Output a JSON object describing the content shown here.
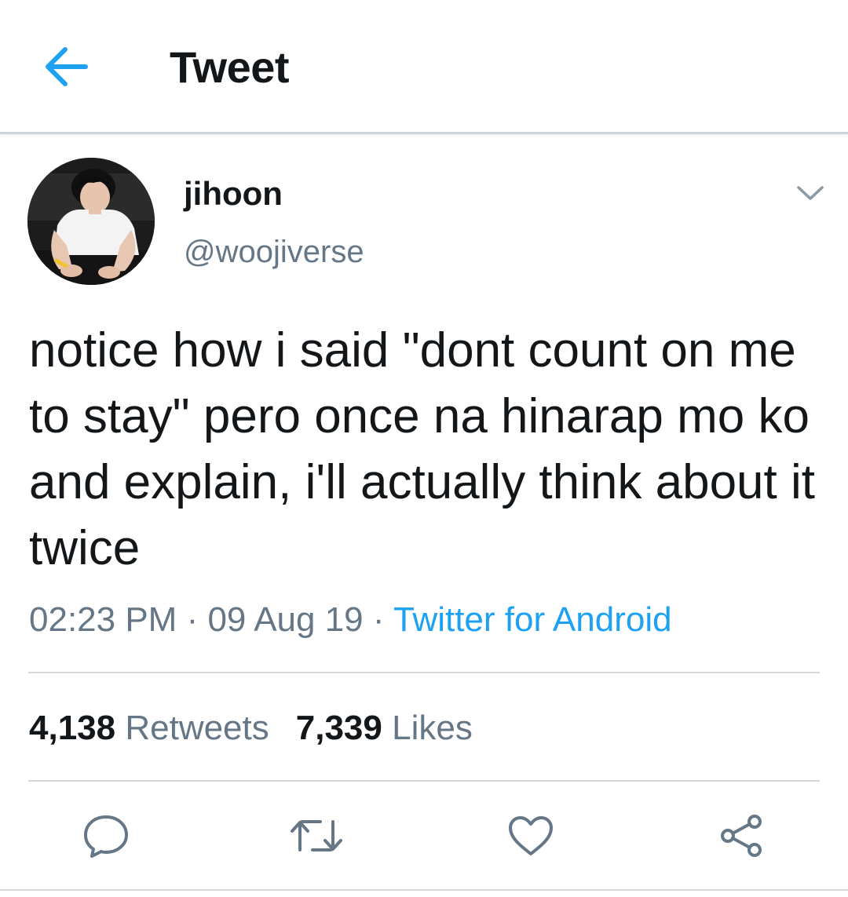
{
  "appbar": {
    "title": "Tweet",
    "back_icon": "arrow-left-icon",
    "accent_color": "#1da1f2"
  },
  "author": {
    "display_name": "jihoon",
    "handle": "@woojiverse",
    "avatar_icon": "user-avatar-photo",
    "caret_icon": "chevron-down-icon"
  },
  "tweet": {
    "text": "notice how i said \"dont count on me to stay\" pero once na hinarap mo ko and explain, i'll actually think about it twice",
    "time": "02:23 PM",
    "separator": " · ",
    "date": "09 Aug 19",
    "source": "Twitter for Android"
  },
  "stats": {
    "retweets_count": "4,138",
    "retweets_label": "Retweets",
    "likes_count": "7,339",
    "likes_label": "Likes"
  },
  "actions": [
    {
      "name": "reply",
      "icon": "reply-icon"
    },
    {
      "name": "retweet",
      "icon": "retweet-icon"
    },
    {
      "name": "like",
      "icon": "heart-icon"
    },
    {
      "name": "share",
      "icon": "share-icon"
    }
  ],
  "colors": {
    "text_primary": "#14171a",
    "text_secondary": "#657786",
    "link": "#1da1f2",
    "divider": "#d4d9de"
  }
}
